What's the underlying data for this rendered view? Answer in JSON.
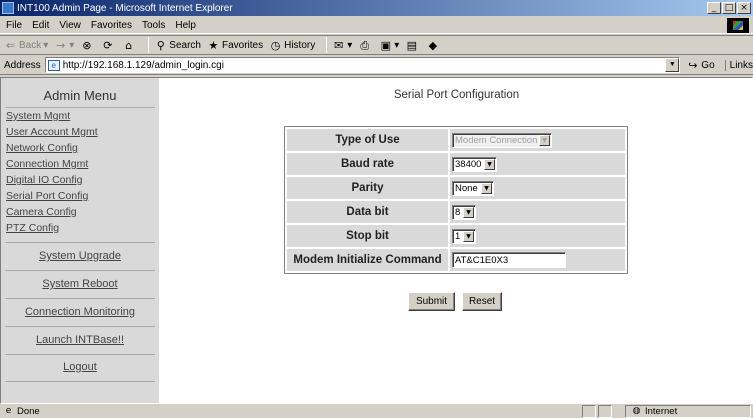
{
  "window": {
    "title": "INT100 Admin Page - Microsoft Internet Explorer"
  },
  "menu": [
    "File",
    "Edit",
    "View",
    "Favorites",
    "Tools",
    "Help"
  ],
  "toolbar": {
    "back": "Back",
    "search": "Search",
    "favorites": "Favorites",
    "history": "History"
  },
  "address": {
    "label": "Address",
    "url": "http://192.168.1.129/admin_login.cgi",
    "go": "Go",
    "links": "Links"
  },
  "sidebar": {
    "title": "Admin Menu",
    "links": [
      "System Mgmt",
      "User Account Mgmt",
      "Network Config",
      "Connection Mgmt",
      "Digital IO Config",
      "Serial Port Config",
      "Camera Config",
      "PTZ Config"
    ],
    "actions": [
      "System Upgrade",
      "System Reboot",
      "Connection Monitoring",
      "Launch INTBase!!",
      "Logout"
    ]
  },
  "main": {
    "title": "Serial Port Configuration",
    "rows": [
      {
        "label": "Type of Use",
        "value": "Modem Connection"
      },
      {
        "label": "Baud rate",
        "value": "38400"
      },
      {
        "label": "Parity",
        "value": "None"
      },
      {
        "label": "Data bit",
        "value": "8"
      },
      {
        "label": "Stop bit",
        "value": "1"
      },
      {
        "label": "Modem Initialize Command",
        "value": "AT&C1E0X3"
      }
    ],
    "submit": "Submit",
    "reset": "Reset"
  },
  "status": {
    "text": "Done",
    "zone": "Internet"
  }
}
